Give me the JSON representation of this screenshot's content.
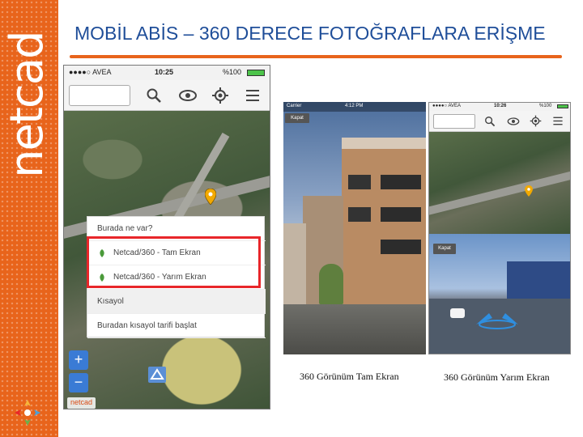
{
  "slide": {
    "title": "MOBİL ABİS – 360 DERECE FOTOĞRAFLARA ERİŞME",
    "brand_word": "netcad",
    "accent_color": "#e8641b",
    "title_color": "#1f4e99"
  },
  "phone_map": {
    "status": {
      "carrier": "●●●●○ AVEA",
      "time": "10:25",
      "battery": "%100"
    },
    "toolbar": {
      "icons": [
        "search-icon",
        "eye-icon",
        "locate-icon",
        "menu-icon"
      ]
    },
    "context_menu": {
      "title": "Burada ne var?",
      "items": [
        "Netcad/360 - Tam Ekran",
        "Netcad/360 - Yarım Ekran"
      ],
      "section_label": "Kısayol",
      "shortcut_action": "Buradan kısayol tarifi başlat"
    },
    "zoom": {
      "in": "+",
      "out": "−"
    },
    "logo_text": "netcad"
  },
  "phone_full": {
    "status": {
      "carrier": "Carrier",
      "time": "4:12 PM"
    },
    "close_label": "Kapat",
    "caption": "360 Görünüm Tam Ekran"
  },
  "phone_half": {
    "status": {
      "carrier": "●●●●○ AVEA",
      "time": "10:26",
      "battery": "%100"
    },
    "close_label": "Kapat",
    "caption": "360 Görünüm Yarım Ekran"
  }
}
